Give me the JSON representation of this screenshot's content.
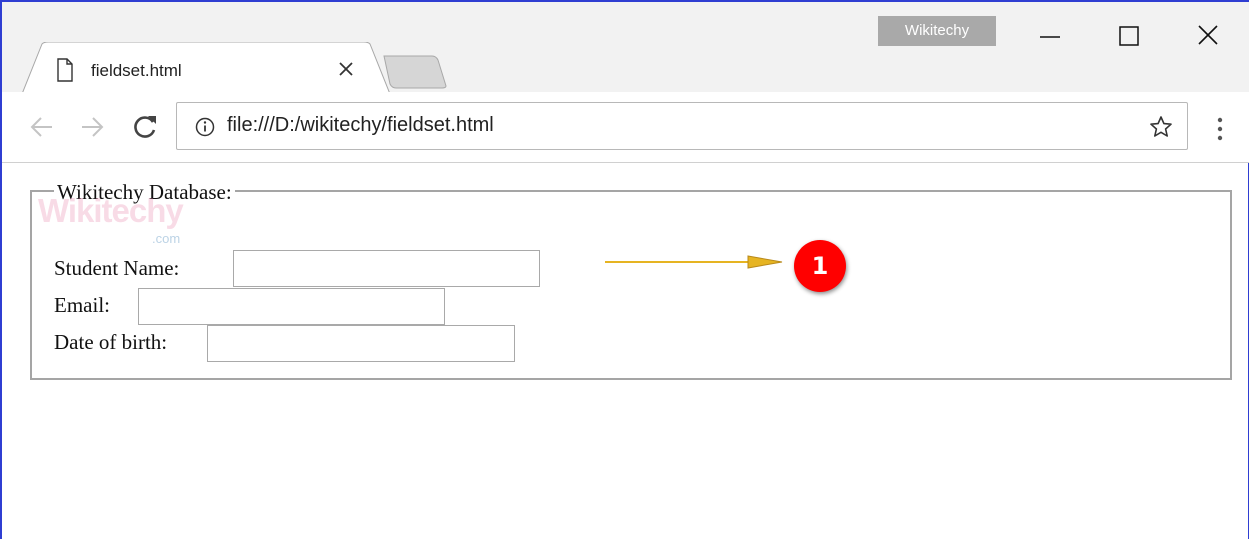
{
  "window": {
    "profile_label": "Wikitechy",
    "controls": [
      "minimize",
      "maximize",
      "close"
    ]
  },
  "tabs": [
    {
      "title": "fieldset.html",
      "icon": "page-icon",
      "close_icon": "close-icon"
    }
  ],
  "toolbar": {
    "url": "file:///D:/wikitechy/fieldset.html",
    "icons": [
      "back-icon",
      "forward-icon",
      "reload-icon",
      "info-icon",
      "star-icon",
      "menu-icon"
    ]
  },
  "page": {
    "legend": "Wikitechy Database:",
    "watermark": "Wikitechy",
    "watermark_suffix": ".com",
    "fields": [
      {
        "label": "Student Name:",
        "value": ""
      },
      {
        "label": "Email:",
        "value": ""
      },
      {
        "label": "Date of birth:",
        "value": ""
      }
    ],
    "annotation": {
      "number": "1"
    }
  },
  "colors": {
    "window_border": "#2f3ed2",
    "badge": "#ff0000",
    "arrow": "#e6b422"
  }
}
